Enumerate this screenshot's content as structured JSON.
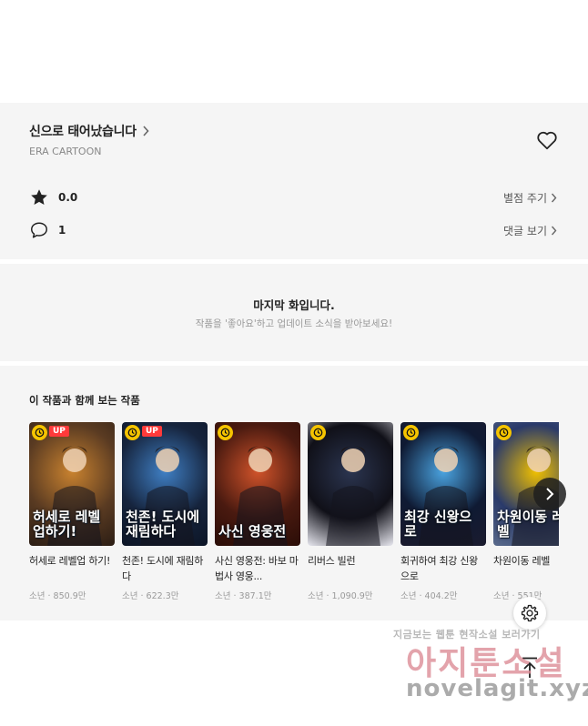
{
  "work": {
    "title": "신으로 태어났습니다",
    "author": "ERA CARTOON"
  },
  "stats": {
    "rating": "0.0",
    "rate_link": "별점 주기",
    "comments": "1",
    "comments_link": "댓글 보기"
  },
  "last_episode": {
    "title": "마지막 화입니다.",
    "subtitle": "작품을 '좋아요'하고 업데이트 소식을 받아보세요!"
  },
  "recommend": {
    "heading": "이 작품과 함께 보는 작품",
    "items": [
      {
        "title": "허세로 레벨업 하기!",
        "meta": "소년 · 850.9만",
        "up": "UP",
        "art": "허세로 레벨업하기!",
        "colors": [
          "#5a3b22",
          "#c9822f",
          "#2b1d14"
        ]
      },
      {
        "title": "천존! 도시에 재림하다",
        "meta": "소년 · 622.3만",
        "up": "UP",
        "art": "천존! 도시에 재림하다",
        "colors": [
          "#16243d",
          "#3f7fc4",
          "#0c1526"
        ]
      },
      {
        "title": "사신 영웅전: 바보 마법사 영웅...",
        "meta": "소년 · 387.1만",
        "up": "",
        "art": "사신 영웅전",
        "colors": [
          "#4a1a10",
          "#d0532a",
          "#2a0d07"
        ]
      },
      {
        "title": "리버스 빌런",
        "meta": "소년 · 1,090.9만",
        "up": "",
        "art": "",
        "colors": [
          "#101018",
          "#2b3550",
          "#e8e8f0"
        ]
      },
      {
        "title": "회귀하여 최강 신왕으로",
        "meta": "소년 · 404.2만",
        "up": "",
        "art": "최강 신왕으로",
        "colors": [
          "#0f1a33",
          "#4aa3e0",
          "#1b1b2e"
        ]
      },
      {
        "title": "차원이동 레벨",
        "meta": "소년 · 551만",
        "up": "",
        "art": "차원이동 레벨",
        "colors": [
          "#2a3a6a",
          "#f0c000",
          "#5a6b8c"
        ]
      }
    ]
  },
  "watermark": {
    "line1": "지금보는 웹툰 현작소설 보러가기",
    "line2": "아지툰소설",
    "line3": "novelagit.xyz"
  },
  "colors": {
    "panel_bg": "#f5f5f5",
    "up_badge": "#ff3a3a",
    "clock_badge": "#f5c400"
  }
}
